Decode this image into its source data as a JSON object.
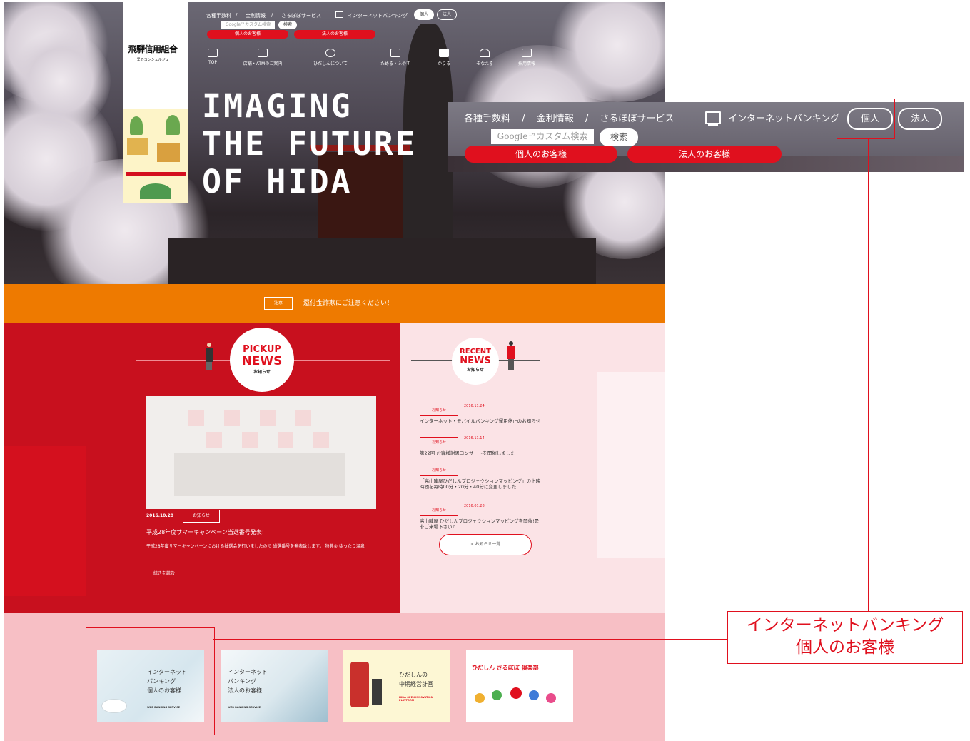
{
  "header": {
    "links": [
      "各種手数料",
      "金利情報",
      "さるぼぼサービス"
    ],
    "separator": "/",
    "internet_banking": "インターネットバンキング",
    "personal_btn": "個人",
    "corporate_btn": "法人",
    "search_placeholder": "Google™カスタム検索",
    "search_btn": "検索",
    "personal_customers": "個人のお客様",
    "corporate_customers": "法人のお客様"
  },
  "logo": {
    "name": "飛騨信用組合",
    "subtitle": "里のコンシェルジュ"
  },
  "nav": [
    {
      "label": "TOP",
      "icon": "bank-icon"
    },
    {
      "label": "店舗・ATMのご案内",
      "icon": "map-icon"
    },
    {
      "label": "ひだしんについて",
      "icon": "question-icon"
    },
    {
      "label": "ためる・ふやす",
      "icon": "piggy-icon"
    },
    {
      "label": "かりる",
      "icon": "bag-icon"
    },
    {
      "label": "そなえる",
      "icon": "umbrella-icon"
    },
    {
      "label": "採用情報",
      "icon": "people-icon"
    }
  ],
  "hero": {
    "tagline": [
      "IMAGING",
      "THE FUTURE",
      "OF HIDA"
    ]
  },
  "notice": {
    "tag": "注意",
    "text": "還付金詐欺にご注意ください！"
  },
  "pickup": {
    "title_line1": "PICKUP",
    "title_line2": "NEWS",
    "subtitle": "お知らせ",
    "date": "2016.10.28",
    "category": "お知らせ",
    "headline": "平成28年度サマーキャンペーン当選番号発表!",
    "body": "平成28年度サマーキャンペーンにおける抽選会を行いましたので 当選番号を発表致します。 特典② ゆったり温泉",
    "more": "続きを読む"
  },
  "recent": {
    "title_line1": "RECENT",
    "title_line2": "NEWS",
    "subtitle": "お知らせ",
    "items": [
      {
        "category": "お知らせ",
        "date": "2016.11.24",
        "text": "インターネット・モバイルバンキング運用停止のお知らせ"
      },
      {
        "category": "お知らせ",
        "date": "2016.11.14",
        "text": "第22回 お客様謝恩コンサートを開催しました"
      },
      {
        "category": "お知らせ",
        "date": "",
        "text": "「高山陣屋ひだしんプロジェクションマッピング」の上映時間を毎時00分・20分・40分に変更しました!"
      },
      {
        "category": "お知らせ",
        "date": "2016.01.28",
        "text": "高山陣屋 ひだしんプロジェクションマッピングを開催!是非ご来場下さい♪"
      }
    ],
    "more": "> お知らせ一覧"
  },
  "banners": [
    {
      "title": "インターネット\nバンキング\n個人のお客様",
      "sub": "WEB BANKING SERVICE"
    },
    {
      "title": "インターネット\nバンキング\n法人のお客様",
      "sub": "WEB BANKING SERVICE"
    },
    {
      "title": "ひだしんの\n中期経営計画",
      "sub": "HIDA OPEN INNOVATION PLATFORM"
    },
    {
      "title": "ひだしん さるぼぼ 倶楽部",
      "sub": ""
    }
  ],
  "callout": {
    "line1": "インターネットバンキング",
    "line2": "個人のお客様"
  },
  "colors": {
    "brand_red": "#e0101e",
    "orange": "#ee7a00",
    "pink": "#f7bfc5"
  }
}
